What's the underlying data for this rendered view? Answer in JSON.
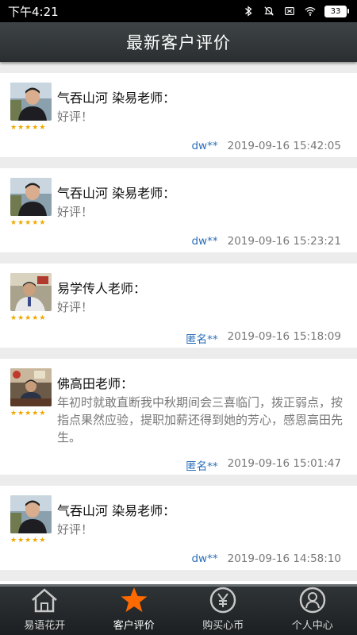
{
  "status": {
    "time": "下午4:21",
    "battery": "33"
  },
  "header": {
    "title": "最新客户评价"
  },
  "reviews": [
    {
      "teacher": "气吞山河 染易老师：",
      "text": "好评！",
      "user": "dw**",
      "time": "2019-09-16 15:42:05",
      "rating": 5,
      "avatar": "young-man-photo"
    },
    {
      "teacher": "气吞山河 染易老师：",
      "text": "好评！",
      "user": "dw**",
      "time": "2019-09-16 15:23:21",
      "rating": 5,
      "avatar": "young-man-photo"
    },
    {
      "teacher": "易学传人老师：",
      "text": "好评！",
      "user": "匿名**",
      "time": "2019-09-16 15:18:09",
      "rating": 5,
      "avatar": "man-in-office-photo"
    },
    {
      "teacher": "佛高田老师：",
      "text": "年初时就敢直断我中秋期间会三喜临门，拨正弱点，按指点果然应验，提职加薪还得到她的芳心，感恩高田先生。",
      "user": "匿名**",
      "time": "2019-09-16 15:01:47",
      "rating": 5,
      "avatar": "man-at-desk-photo"
    },
    {
      "teacher": "气吞山河 染易老师：",
      "text": "好评！",
      "user": "dw**",
      "time": "2019-09-16 14:58:10",
      "rating": 5,
      "avatar": "young-man-photo"
    }
  ],
  "tabs": [
    {
      "label": "易语花开",
      "icon": "home-icon",
      "active": false
    },
    {
      "label": "客户评价",
      "icon": "star-icon",
      "active": true
    },
    {
      "label": "购买心币",
      "icon": "yen-coin-icon",
      "active": false
    },
    {
      "label": "个人中心",
      "icon": "person-icon",
      "active": false
    }
  ],
  "colors": {
    "accent": "#ff6a00",
    "user_link": "#2a6fb8",
    "star": "#f0a800"
  }
}
